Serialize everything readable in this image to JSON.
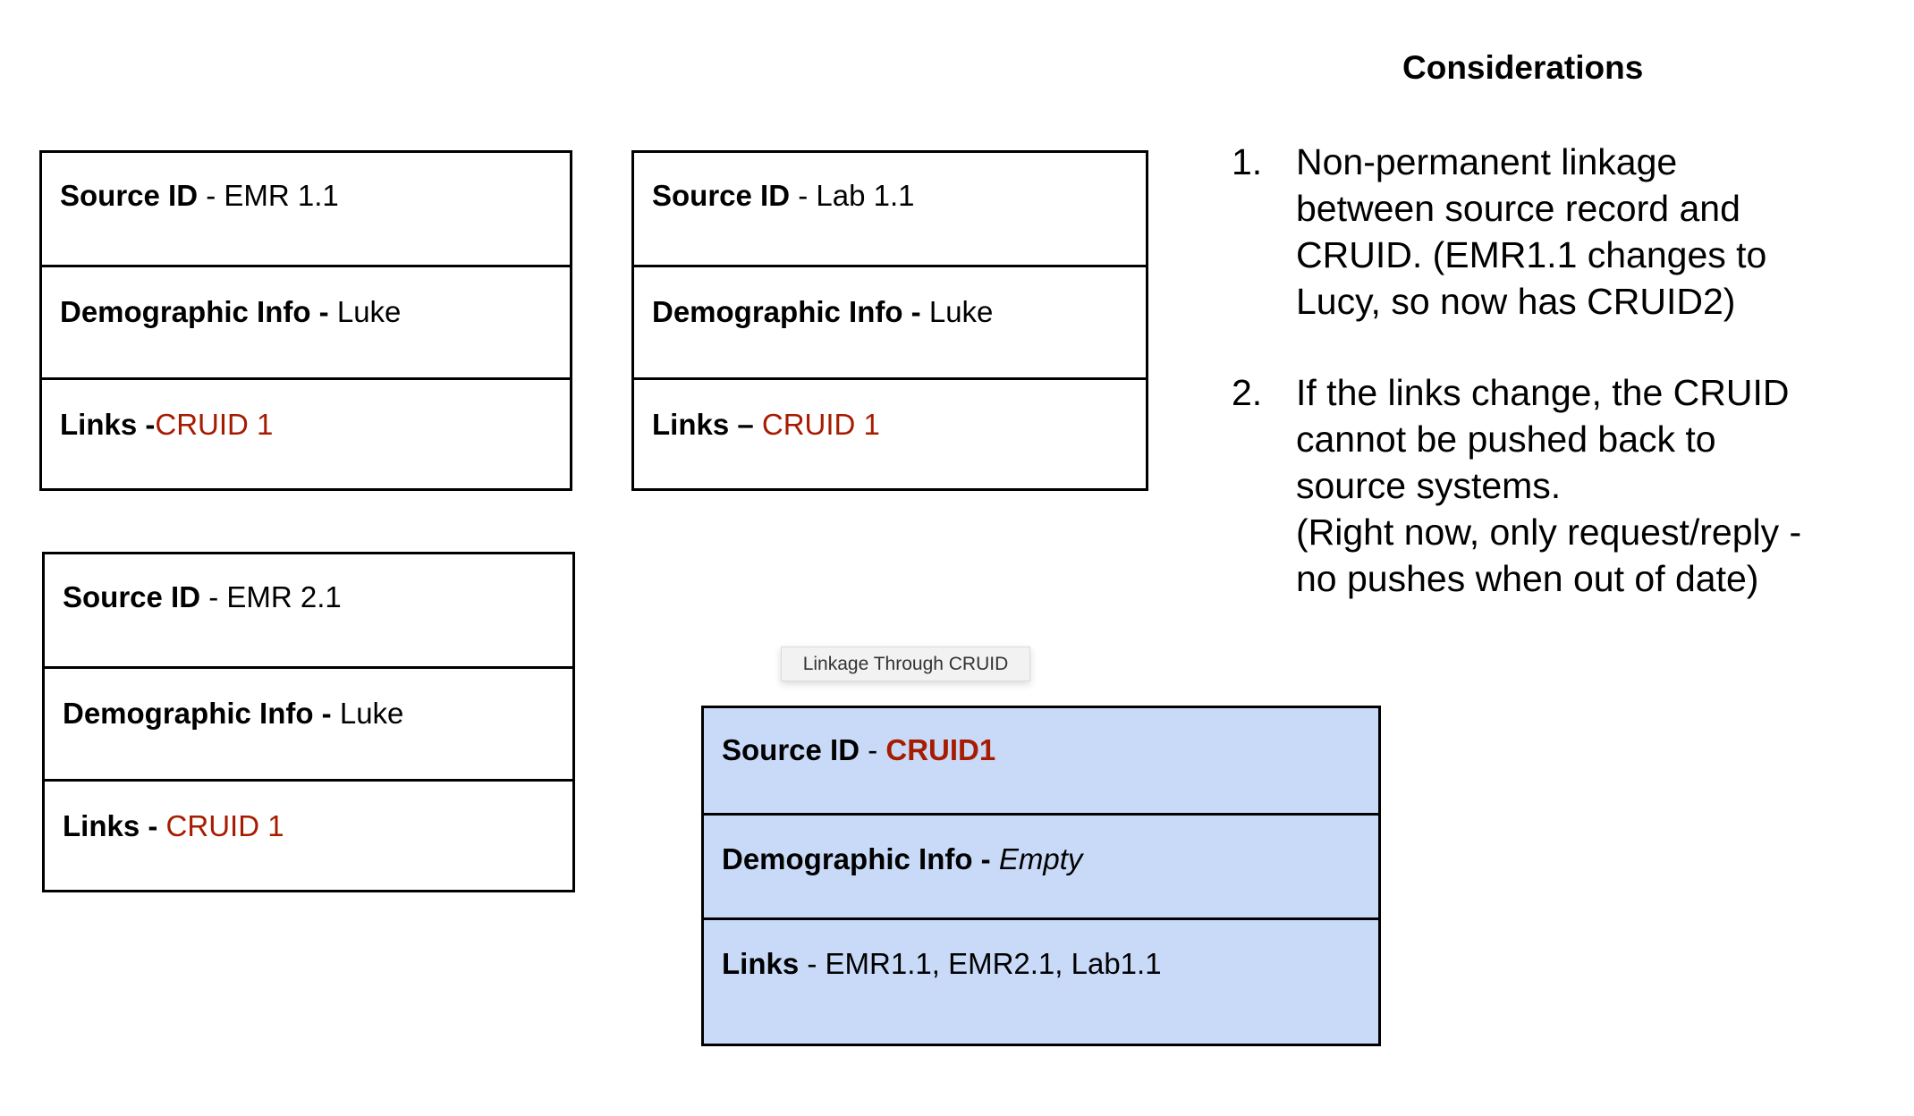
{
  "records": [
    {
      "id": "emr11",
      "rows": [
        {
          "label": "Source ID",
          "sep": " - ",
          "value": "EMR 1.1",
          "style": ""
        },
        {
          "label": "Demographic Info - ",
          "sep": "",
          "value": "Luke",
          "style": ""
        },
        {
          "label": "Links -",
          "sep": "",
          "value": "CRUID 1",
          "style": "red"
        }
      ]
    },
    {
      "id": "lab11",
      "rows": [
        {
          "label": "Source ID",
          "sep": " - ",
          "value": "Lab 1.1",
          "style": ""
        },
        {
          "label": "Demographic Info - ",
          "sep": "",
          "value": "Luke",
          "style": ""
        },
        {
          "label": "Links – ",
          "sep": "",
          "value": "CRUID 1",
          "style": "red"
        }
      ]
    },
    {
      "id": "emr21",
      "rows": [
        {
          "label": "Source ID",
          "sep": " - ",
          "value": "EMR 2.1",
          "style": ""
        },
        {
          "label": "Demographic Info - ",
          "sep": "",
          "value": "Luke",
          "style": ""
        },
        {
          "label": "Links - ",
          "sep": "",
          "value": "CRUID 1",
          "style": "red"
        }
      ]
    },
    {
      "id": "cruid",
      "rows": [
        {
          "label": "Source ID",
          "sep": " - ",
          "value": "CRUID1",
          "style": "red bold"
        },
        {
          "label": "Demographic Info - ",
          "sep": "",
          "value": "Empty",
          "style": "italic"
        },
        {
          "label": "Links",
          "sep": " - ",
          "value": "EMR1.1, EMR2.1, Lab1.1",
          "style": ""
        }
      ]
    }
  ],
  "tooltip": "Linkage Through CRUID",
  "considerations": {
    "title": "Considerations",
    "items": [
      {
        "number": "1.",
        "lines": [
          "Non-permanent linkage",
          "between source record and",
          "CRUID. (EMR1.1 changes to",
          "Lucy, so now has CRUID2)"
        ]
      },
      {
        "number": "2.",
        "lines": [
          "If the links change, the CRUID",
          "cannot be pushed back to",
          "source systems.",
          "(Right now, only request/reply -",
          "no pushes when out of date)"
        ]
      }
    ]
  },
  "colors": {
    "link_red": "#a61c00",
    "cruid_fill": "#c9daf8",
    "border": "#000000"
  }
}
